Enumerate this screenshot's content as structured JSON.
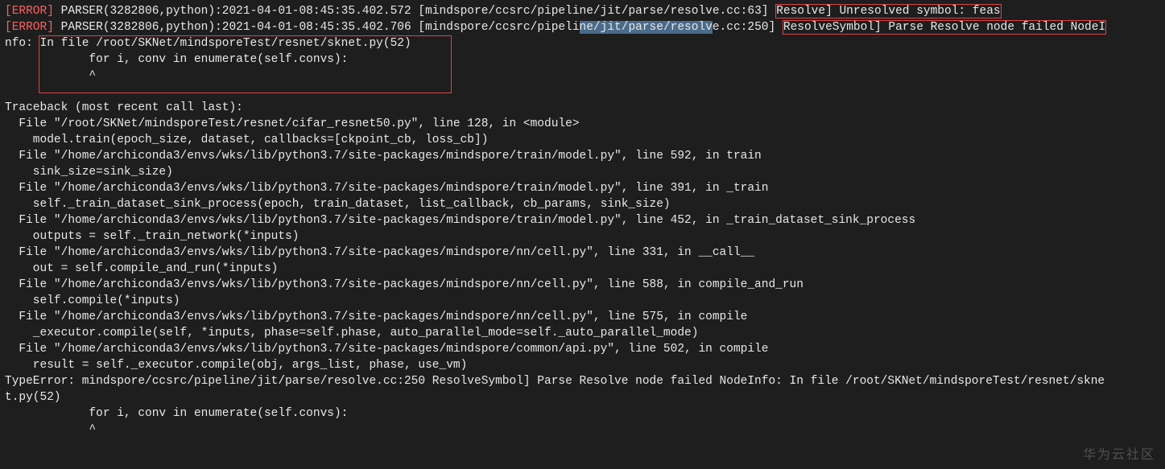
{
  "errors": [
    {
      "prefix": "[ERROR] PARSER(3282806,python):2021-04-01-08:45:35.402.572 [mindspore/ccsrc/pipeline/jit/parse/resolve.cc:63] ",
      "boxed": "Resolve] Unresolved symbol: feas"
    },
    {
      "prefix": "[ERROR] PARSER(3282806,python):2021-04-01-08:45:35.402.706 [mindspore/ccsrc/pipeli",
      "selected": "ne/jit/parse/resolv",
      "after_sel": "e.cc:250] ",
      "boxed": "ResolveSymbol] Parse Resolve node failed NodeI"
    }
  ],
  "nodeinfo": {
    "line1_a": "nfo: ",
    "line1_b": "In file /root/SKNet/mindsporeTest/resnet/sknet.py(52)",
    "line2": "            for i, conv in enumerate(self.convs):",
    "line3": "            ^"
  },
  "tb_header": "Traceback (most recent call last):",
  "frames": [
    {
      "file": "  File \"/root/SKNet/mindsporeTest/resnet/cifar_resnet50.py\", line 128, in <module>",
      "code": "    model.train(epoch_size, dataset, callbacks=[ckpoint_cb, loss_cb])"
    },
    {
      "file": "  File \"/home/archiconda3/envs/wks/lib/python3.7/site-packages/mindspore/train/model.py\", line 592, in train",
      "code": "    sink_size=sink_size)"
    },
    {
      "file": "  File \"/home/archiconda3/envs/wks/lib/python3.7/site-packages/mindspore/train/model.py\", line 391, in _train",
      "code": "    self._train_dataset_sink_process(epoch, train_dataset, list_callback, cb_params, sink_size)"
    },
    {
      "file": "  File \"/home/archiconda3/envs/wks/lib/python3.7/site-packages/mindspore/train/model.py\", line 452, in _train_dataset_sink_process",
      "code": "    outputs = self._train_network(*inputs)"
    },
    {
      "file": "  File \"/home/archiconda3/envs/wks/lib/python3.7/site-packages/mindspore/nn/cell.py\", line 331, in __call__",
      "code": "    out = self.compile_and_run(*inputs)"
    },
    {
      "file": "  File \"/home/archiconda3/envs/wks/lib/python3.7/site-packages/mindspore/nn/cell.py\", line 588, in compile_and_run",
      "code": "    self.compile(*inputs)"
    },
    {
      "file": "  File \"/home/archiconda3/envs/wks/lib/python3.7/site-packages/mindspore/nn/cell.py\", line 575, in compile",
      "code": "    _executor.compile(self, *inputs, phase=self.phase, auto_parallel_mode=self._auto_parallel_mode)"
    },
    {
      "file": "  File \"/home/archiconda3/envs/wks/lib/python3.7/site-packages/mindspore/common/api.py\", line 502, in compile",
      "code": "    result = self._executor.compile(obj, args_list, phase, use_vm)"
    }
  ],
  "type_error": {
    "line1": "TypeError: mindspore/ccsrc/pipeline/jit/parse/resolve.cc:250 ResolveSymbol] Parse Resolve node failed NodeInfo: In file /root/SKNet/mindsporeTest/resnet/skne",
    "line2": "t.py(52)",
    "line3": "            for i, conv in enumerate(self.convs):",
    "line4": "            ^"
  },
  "watermark": "华为云社区"
}
